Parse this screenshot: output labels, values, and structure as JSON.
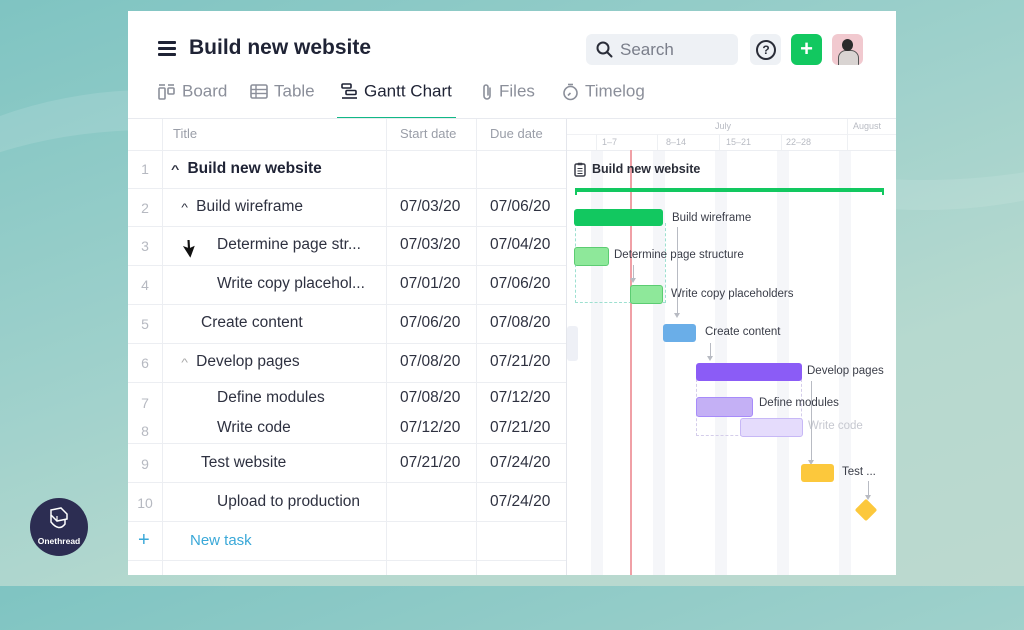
{
  "header": {
    "title": "Build new website",
    "search_placeholder": "Search",
    "help_label": "?",
    "add_label": "+"
  },
  "tabs": [
    {
      "label": "Board",
      "icon": "board-icon",
      "active": false
    },
    {
      "label": "Table",
      "icon": "table-icon",
      "active": false
    },
    {
      "label": "Gantt Chart",
      "icon": "gantt-icon",
      "active": true
    },
    {
      "label": "Files",
      "icon": "paperclip-icon",
      "active": false
    },
    {
      "label": "Timelog",
      "icon": "stopwatch-icon",
      "active": false
    }
  ],
  "table": {
    "columns": [
      "Title",
      "Start date",
      "Due date"
    ],
    "rows": [
      {
        "num": "1",
        "title": "Build new website",
        "start": "",
        "due": "",
        "caret": "^"
      },
      {
        "num": "2",
        "title": "Build wireframe",
        "start": "07/03/20",
        "due": "07/06/20",
        "caret": "^"
      },
      {
        "num": "3",
        "title": "Determine page str...",
        "start": "07/03/20",
        "due": "07/04/20"
      },
      {
        "num": "4",
        "title": "Write copy placehol...",
        "start": "07/01/20",
        "due": "07/06/20"
      },
      {
        "num": "5",
        "title": "Create content",
        "start": "07/06/20",
        "due": "07/08/20"
      },
      {
        "num": "6",
        "title": "Develop pages",
        "start": "07/08/20",
        "due": "07/21/20",
        "caret": "^"
      },
      {
        "num": "7",
        "title": "Define modules",
        "start": "07/08/20",
        "due": "07/12/20"
      },
      {
        "num": "8",
        "title": "Write code",
        "start": "07/12/20",
        "due": "07/21/20"
      },
      {
        "num": "9",
        "title": "Test website",
        "start": "07/21/20",
        "due": "07/24/20"
      },
      {
        "num": "10",
        "title": "Upload to production",
        "start": "",
        "due": "07/24/20"
      }
    ],
    "new_task_plus": "+",
    "new_task_label": "New task"
  },
  "gantt": {
    "months": [
      "July",
      "August"
    ],
    "weeks": [
      "1–7",
      "8–14",
      "15–21",
      "22–28"
    ],
    "project_label": "Build new website",
    "bars": [
      {
        "label": "Build wireframe",
        "color": "#12c860"
      },
      {
        "label": "Determine page structure",
        "color": "#8ee89a"
      },
      {
        "label": "Write copy placeholders",
        "color": "#8ee89a"
      },
      {
        "label": "Create content",
        "color": "#6aaee8"
      },
      {
        "label": "Develop pages",
        "color": "#8b5cf6"
      },
      {
        "label": "Define modules",
        "color": "#c4b0f5"
      },
      {
        "label": "Write code",
        "color": "#e5dcfc"
      },
      {
        "label": "Test ...",
        "color": "#fcc83c"
      },
      {
        "label": "",
        "color": "#fcc83c"
      }
    ]
  },
  "logo": {
    "label": "Onethread"
  }
}
